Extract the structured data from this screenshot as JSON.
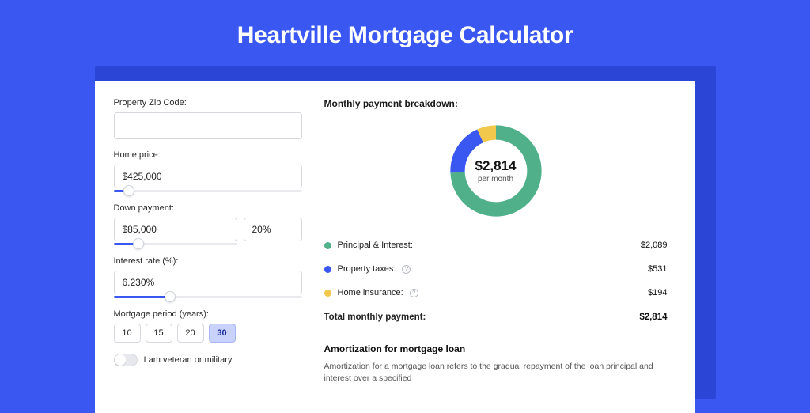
{
  "title": "Heartville Mortgage Calculator",
  "form": {
    "zip_label": "Property Zip Code:",
    "zip_value": "",
    "home_price_label": "Home price:",
    "home_price_value": "$425,000",
    "home_price_slider": 8,
    "down_label": "Down payment:",
    "down_value": "$85,000",
    "down_pct": "20%",
    "down_slider": 20,
    "rate_label": "Interest rate (%):",
    "rate_value": "6.230%",
    "rate_slider": 30,
    "period_label": "Mortgage period (years):",
    "periods": [
      "10",
      "15",
      "20",
      "30"
    ],
    "period_active": "30",
    "veteran_label": "I am veteran or military"
  },
  "breakdown": {
    "title": "Monthly payment breakdown:",
    "amount": "$2,814",
    "per": "per month",
    "items": [
      {
        "label": "Principal & Interest:",
        "value": "$2,089",
        "color": "#4fb08a",
        "info": false
      },
      {
        "label": "Property taxes:",
        "value": "$531",
        "color": "#3a57f2",
        "info": true
      },
      {
        "label": "Home insurance:",
        "value": "$194",
        "color": "#f1c84b",
        "info": true
      }
    ],
    "total_label": "Total monthly payment:",
    "total_value": "$2,814"
  },
  "amort": {
    "title": "Amortization for mortgage loan",
    "text": "Amortization for a mortgage loan refers to the gradual repayment of the loan principal and interest over a specified"
  },
  "chart_data": {
    "type": "pie",
    "title": "Monthly payment breakdown",
    "series": [
      {
        "name": "Principal & Interest",
        "value": 2089,
        "color": "#4fb08a"
      },
      {
        "name": "Property taxes",
        "value": 531,
        "color": "#3a57f2"
      },
      {
        "name": "Home insurance",
        "value": 194,
        "color": "#f1c84b"
      }
    ],
    "total": 2814,
    "center_label": "$2,814 per month"
  }
}
